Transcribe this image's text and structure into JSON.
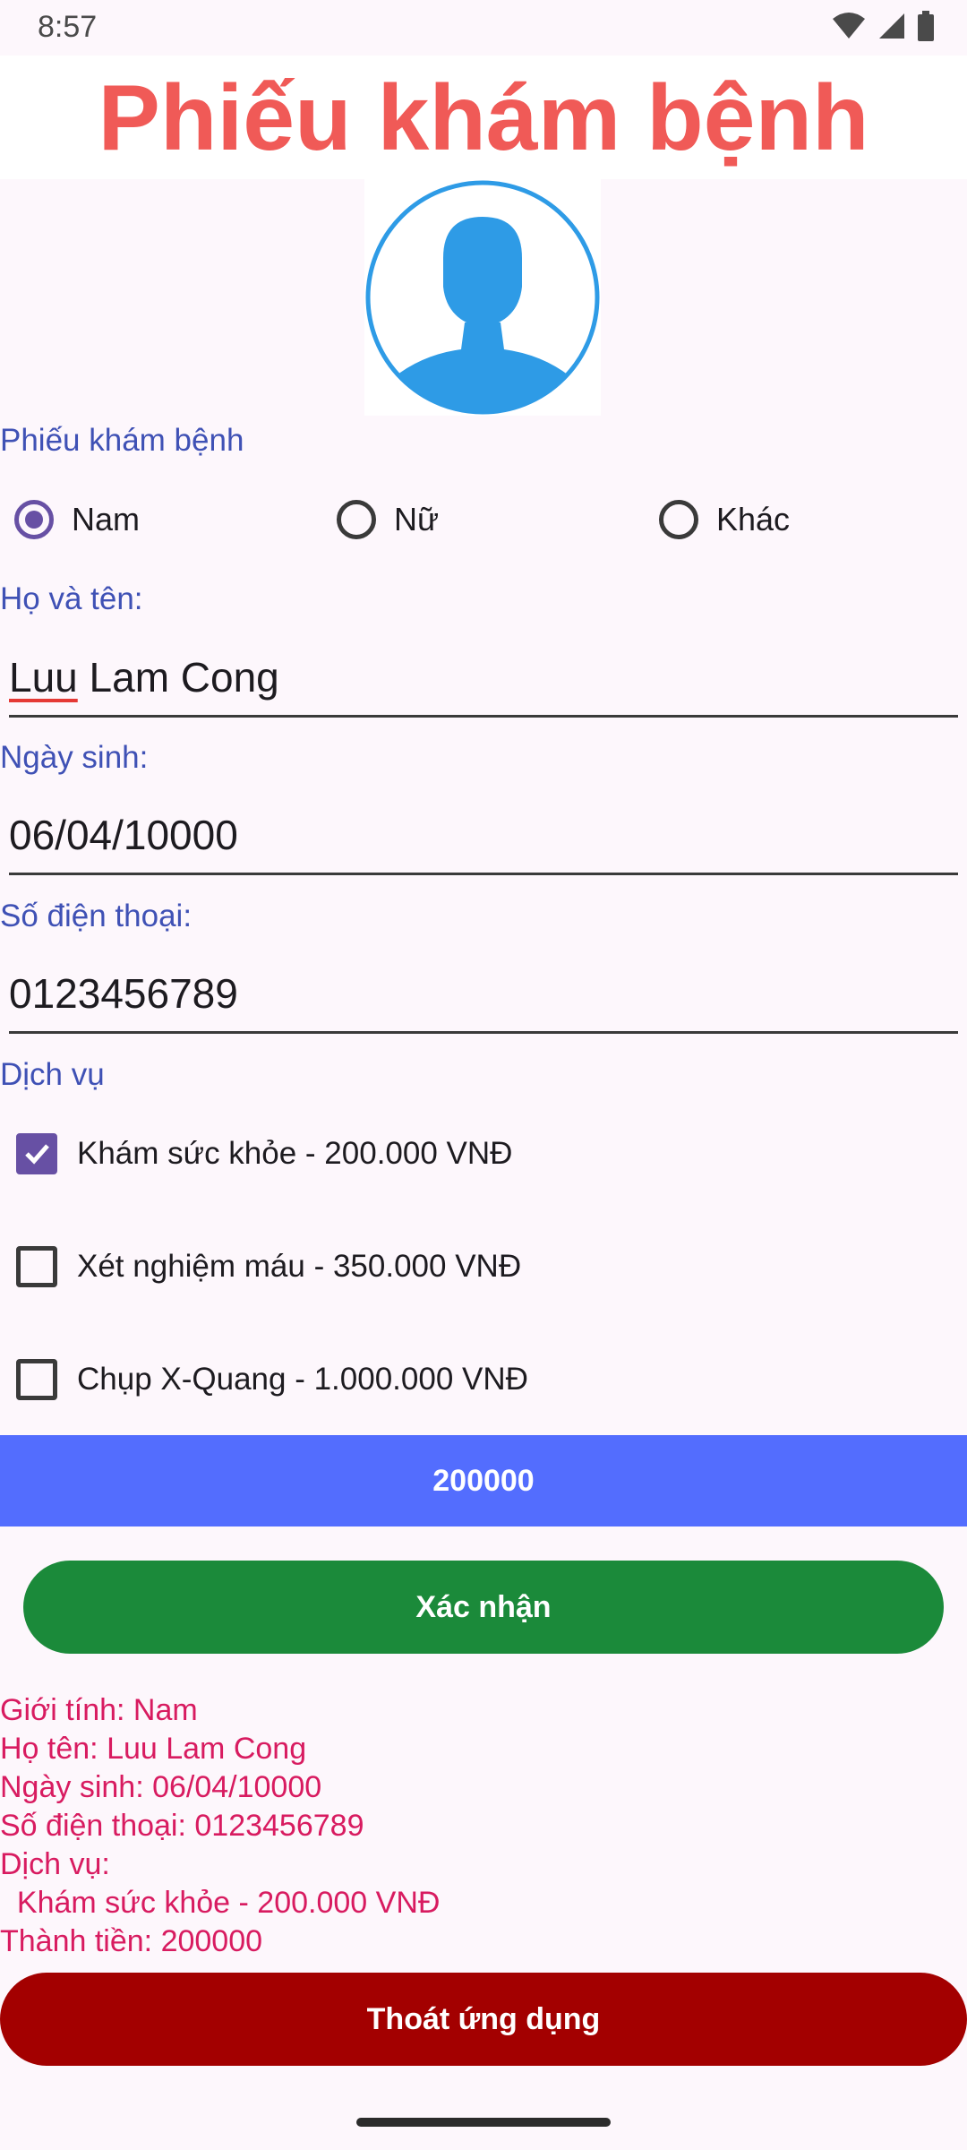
{
  "status_bar": {
    "time": "8:57",
    "icons": [
      "wifi-icon",
      "cellular-signal-icon",
      "battery-icon"
    ]
  },
  "header": {
    "title": "Phiếu khám bệnh"
  },
  "avatar": {
    "icon": "person-avatar-icon",
    "color": "#2E9BE6"
  },
  "gender": {
    "section_label": "Phiếu khám bệnh",
    "options": [
      {
        "label": "Nam",
        "checked": true
      },
      {
        "label": "Nữ",
        "checked": false
      },
      {
        "label": "Khác",
        "checked": false
      }
    ]
  },
  "form": {
    "name_label": "Họ và tên:",
    "name_value_part1": "Luu",
    "name_value_part2": " Lam Cong",
    "dob_label": "Ngày sinh:",
    "dob_value": "06/04/10000",
    "phone_label": "Số điện thoại:",
    "phone_value": "0123456789"
  },
  "services": {
    "section_label": "Dịch vụ",
    "items": [
      {
        "label": "Khám sức khỏe - 200.000 VNĐ",
        "checked": true
      },
      {
        "label": "Xét nghiệm máu - 350.000 VNĐ",
        "checked": false
      },
      {
        "label": "Chụp X-Quang - 1.000.000 VNĐ",
        "checked": false
      }
    ]
  },
  "total_button": {
    "label": "200000",
    "color": "#536DFE"
  },
  "confirm_button": {
    "label": "Xác nhận",
    "color": "#1B8A3A"
  },
  "result": {
    "lines": [
      "Giới tính: Nam",
      "Họ tên: Luu Lam Cong",
      "Ngày sinh: 06/04/10000",
      "Số điện thoại: 0123456789",
      "Dịch vụ:",
      "  Khám sức khỏe - 200.000 VNĐ",
      "Thành tiền: 200000"
    ],
    "color": "#D81B60"
  },
  "exit_button": {
    "label": "Thoát ứng dụng",
    "color": "#A30000"
  },
  "colors": {
    "title": "#F05A57",
    "section_label": "#3F51B5",
    "accent": "#6750A4"
  }
}
